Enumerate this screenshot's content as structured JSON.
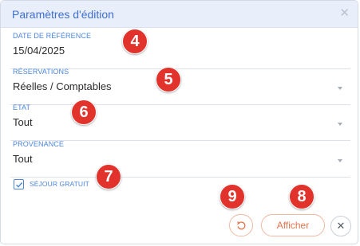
{
  "dialog": {
    "title": "Paramètres d'édition",
    "close_glyph": "✕",
    "fields": [
      {
        "label": "DATE DE RÉFÉRENCE",
        "value": "15/04/2025"
      },
      {
        "label": "RÉSERVATIONS",
        "value": "Réelles / Comptables"
      },
      {
        "label": "ETAT",
        "value": "Tout"
      },
      {
        "label": "PROVENANCE",
        "value": "Tout"
      }
    ],
    "checkbox": {
      "label": "SÉJOUR GRATUIT",
      "checked": true
    },
    "buttons": {
      "reset_icon": "reset-icon",
      "afficher_label": "Afficher",
      "close_label": "✕"
    }
  },
  "markers": [
    "4",
    "5",
    "6",
    "7",
    "8",
    "9"
  ],
  "colors": {
    "accent_blue": "#4d86da",
    "header_bg": "#e9eefb",
    "button_orange": "#e3734c",
    "marker_red": "#e1322b"
  }
}
